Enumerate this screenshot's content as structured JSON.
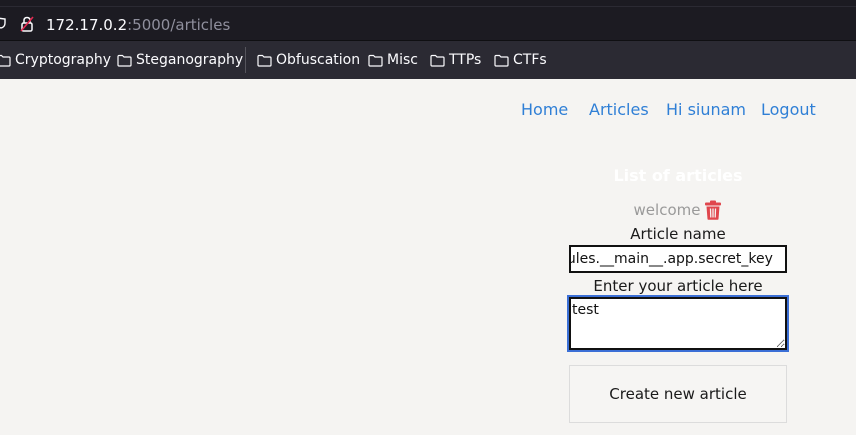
{
  "browser": {
    "url_host": "172.17.0.2",
    "url_path": ":5000/articles",
    "bookmarks": [
      {
        "label": "Cryptography",
        "icon": "folder-icon"
      },
      {
        "label": "Steganography",
        "icon": "folder-icon"
      },
      {
        "label": "Obfuscation",
        "icon": "folder-icon"
      },
      {
        "label": "Misc",
        "icon": "folder-icon"
      },
      {
        "label": "TTPs",
        "icon": "folder-icon"
      },
      {
        "label": "CTFs",
        "icon": "folder-icon"
      }
    ]
  },
  "nav": {
    "home": "Home",
    "articles": "Articles",
    "greeting": "Hi siunam",
    "logout": "Logout"
  },
  "articles_panel": {
    "title": "List of articles",
    "items": [
      {
        "name": "welcome",
        "delete_icon": "trash-icon"
      }
    ],
    "name_label": "Article name",
    "name_value": "{{modules.__main__.app.secret_key}}",
    "visible_name_value": "lules.__main__.app.secret_key",
    "body_label": "Enter your article here",
    "body_value": "test",
    "submit_label": "Create new article"
  },
  "colors": {
    "link": "#2f7fd6",
    "page_bg": "#f5f4f2",
    "chrome_bg": "#1c1b22",
    "bookmarks_bg": "#2b2a33",
    "trash": "#e0464d"
  }
}
